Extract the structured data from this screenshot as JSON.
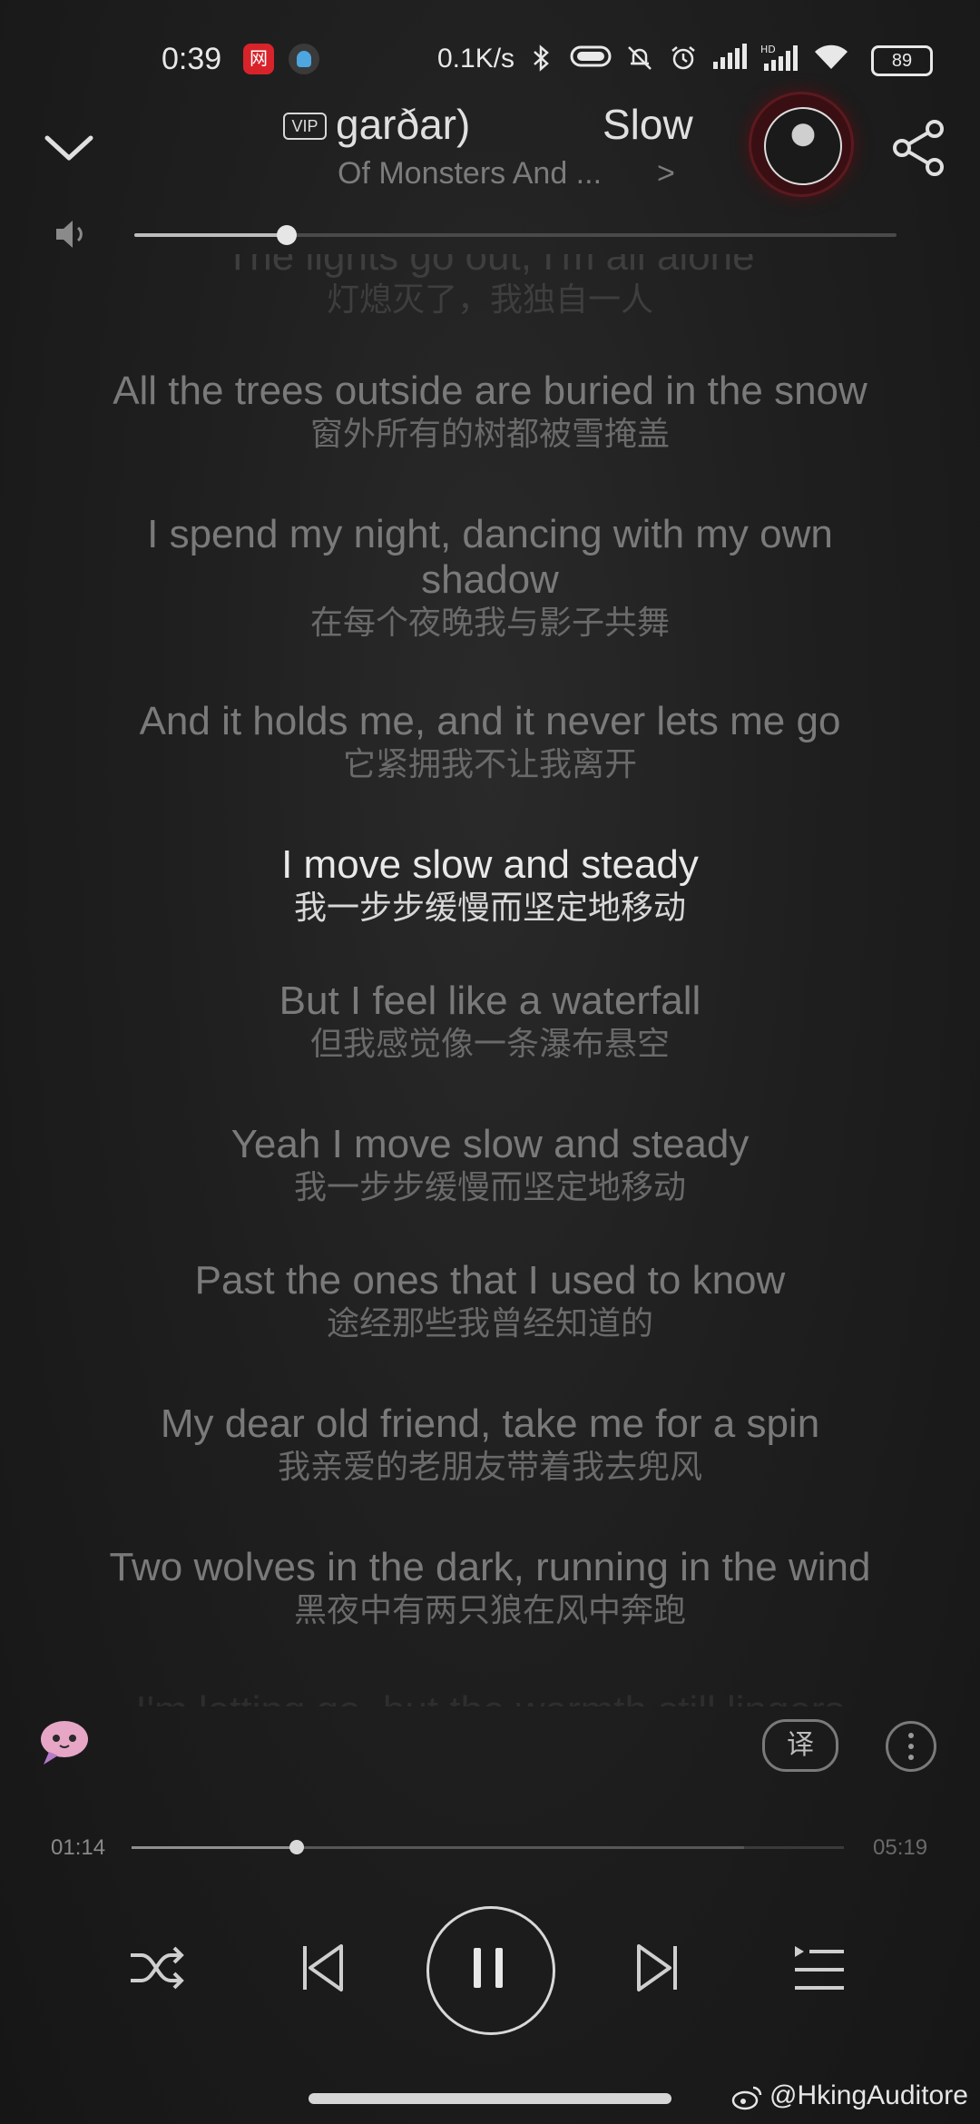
{
  "status_bar": {
    "time": "0:39",
    "app_icon_label": "网",
    "network_speed": "0.1K/s",
    "battery": "89",
    "icons": [
      "bluetooth-icon",
      "toggle-icon",
      "silent-bell-icon",
      "alarm-icon",
      "signal-icon",
      "signal-hd-icon",
      "wifi-icon"
    ]
  },
  "header": {
    "vip_badge": "VIP",
    "song_title_part1": "garðar)",
    "song_title_part2": "Slow",
    "artist": "Of Monsters And ...",
    "artist_arrow": ">"
  },
  "volume": {
    "level": 0.2
  },
  "lyrics": [
    {
      "en": "The lights go out, I'm all alone",
      "zh": "灯熄灭了，我独自一人",
      "state": "faded"
    },
    {
      "en": "All the trees outside are buried in the snow",
      "zh": "窗外所有的树都被雪掩盖",
      "state": "normal"
    },
    {
      "en": "I spend my night, dancing with my own",
      "en2": "shadow",
      "zh": "在每个夜晚我与影子共舞",
      "state": "normal"
    },
    {
      "en": "And it holds me, and it never lets me go",
      "zh": "它紧拥我不让我离开",
      "state": "normal"
    },
    {
      "en": "I move slow and steady",
      "zh": "我一步步缓慢而坚定地移动",
      "state": "current"
    },
    {
      "en": "But I feel like a waterfall",
      "zh": "但我感觉像一条瀑布悬空",
      "state": "normal"
    },
    {
      "en": "Yeah I move slow and steady",
      "zh": "我一步步缓慢而坚定地移动",
      "state": "normal"
    },
    {
      "en": "Past the ones that I used to know",
      "zh": "途经那些我曾经知道的",
      "state": "normal"
    },
    {
      "en": "My dear old friend, take me for a spin",
      "zh": "我亲爱的老朋友带着我去兜风",
      "state": "normal"
    },
    {
      "en": "Two wolves in the dark, running in the wind",
      "zh": "黑夜中有两只狼在风中奔跑",
      "state": "normal"
    },
    {
      "en": "I'm letting go, but the warmth still lingers",
      "zh": "",
      "state": "faded"
    }
  ],
  "tools": {
    "translate_label": "译"
  },
  "progress": {
    "current": "01:14",
    "total": "05:19",
    "played_fraction": 0.232,
    "buffered_fraction": 0.86
  },
  "watermark": "@HkingAuditore"
}
